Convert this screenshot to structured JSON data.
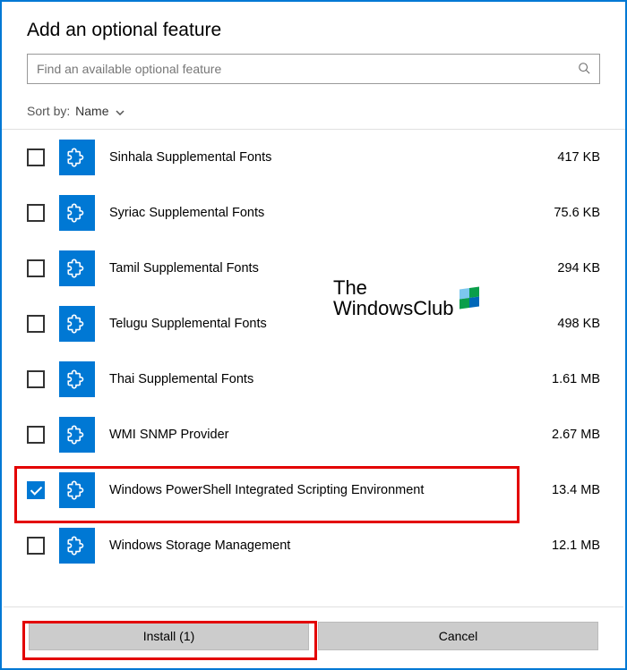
{
  "title": "Add an optional feature",
  "search": {
    "placeholder": "Find an available optional feature"
  },
  "sort": {
    "label": "Sort by:",
    "value": "Name"
  },
  "features": [
    {
      "name": "Sinhala Supplemental Fonts",
      "size": "417 KB",
      "checked": false
    },
    {
      "name": "Syriac Supplemental Fonts",
      "size": "75.6 KB",
      "checked": false
    },
    {
      "name": "Tamil Supplemental Fonts",
      "size": "294 KB",
      "checked": false
    },
    {
      "name": "Telugu Supplemental Fonts",
      "size": "498 KB",
      "checked": false
    },
    {
      "name": "Thai Supplemental Fonts",
      "size": "1.61 MB",
      "checked": false
    },
    {
      "name": "WMI SNMP Provider",
      "size": "2.67 MB",
      "checked": false
    },
    {
      "name": "Windows PowerShell Integrated Scripting Environment",
      "size": "13.4 MB",
      "checked": true
    },
    {
      "name": "Windows Storage Management",
      "size": "12.1 MB",
      "checked": false
    }
  ],
  "buttons": {
    "install": "Install (1)",
    "cancel": "Cancel"
  },
  "watermark": {
    "line1": "The",
    "line2": "WindowsClub"
  }
}
